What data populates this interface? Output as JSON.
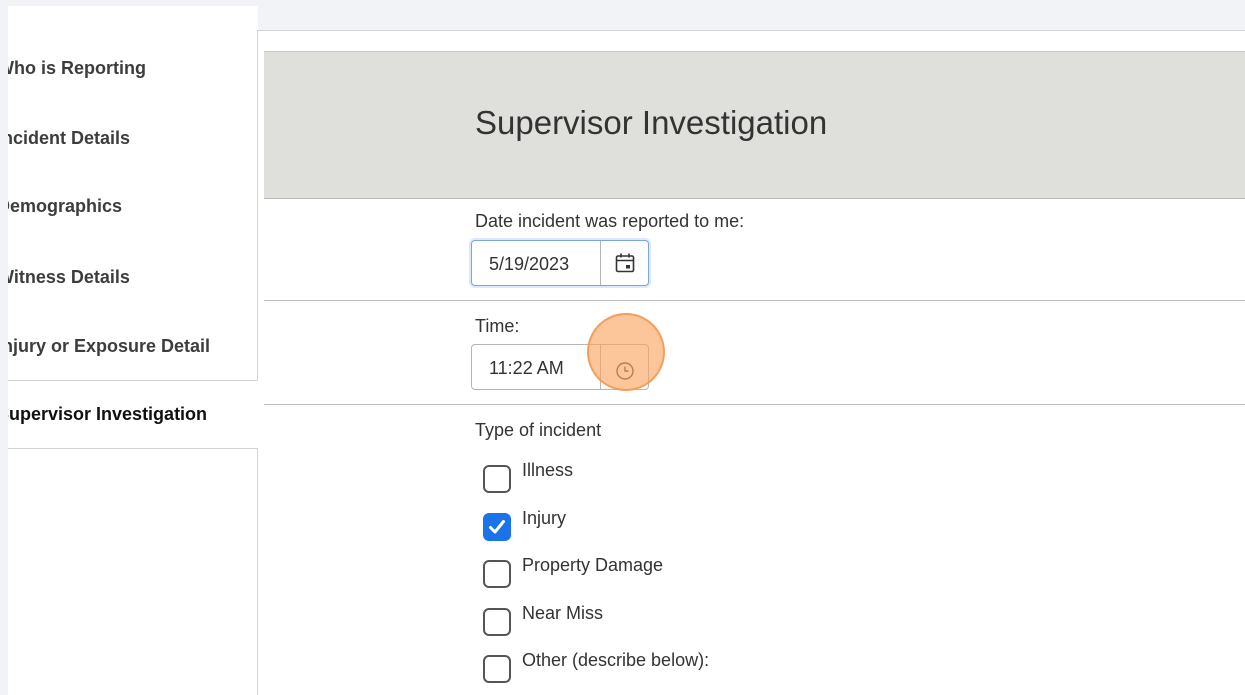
{
  "sidebar": {
    "items": [
      {
        "label": "Who is Reporting"
      },
      {
        "label": "Incident Details"
      },
      {
        "label": "Demographics"
      },
      {
        "label": "Witness Details"
      },
      {
        "label": "Injury or Exposure Detail"
      },
      {
        "label": "Supervisor Investigation",
        "active": true
      }
    ]
  },
  "main": {
    "title": "Supervisor Investigation",
    "date_field": {
      "label": "Date incident was reported to me:",
      "value": "5/19/2023",
      "icon": "calendar-icon"
    },
    "time_field": {
      "label": "Time:",
      "value": "11:22 AM",
      "icon": "clock-icon"
    },
    "incident_type": {
      "label": "Type of incident",
      "options": [
        {
          "label": "Illness",
          "checked": false
        },
        {
          "label": "Injury",
          "checked": true
        },
        {
          "label": "Property Damage",
          "checked": false
        },
        {
          "label": "Near Miss",
          "checked": false
        },
        {
          "label": "Other (describe below):",
          "checked": false
        }
      ]
    }
  },
  "colors": {
    "accent": "#1a73e8",
    "header_band": "#dfdfdb",
    "click_highlight": "#faa35c"
  }
}
